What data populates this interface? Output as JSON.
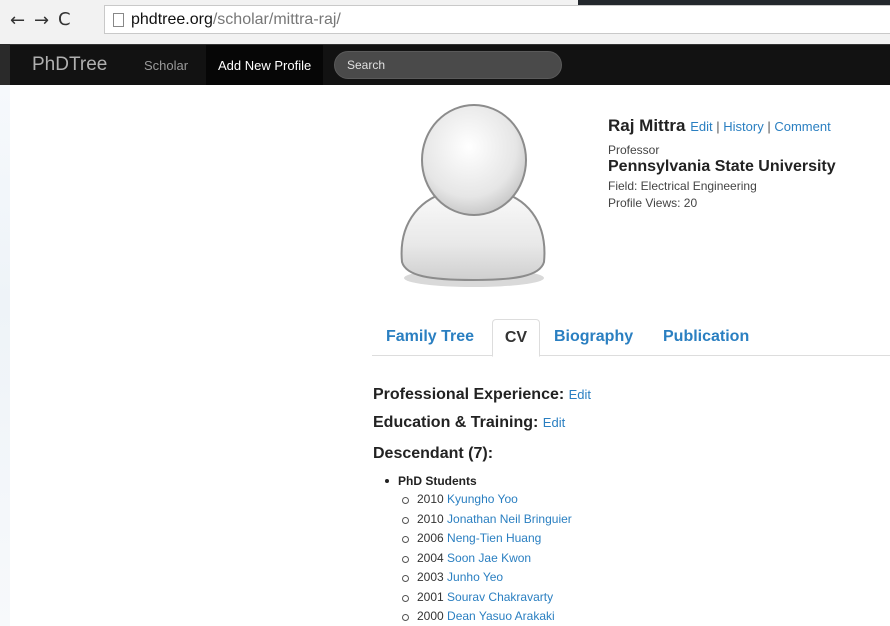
{
  "browser": {
    "url_host": "phdtree.org",
    "url_path": "/scholar/mittra-raj/",
    "back_icon": "←",
    "forward_icon": "→",
    "reload_icon": "C"
  },
  "navbar": {
    "brand": "PhDTree",
    "scholar": "Scholar",
    "add_profile": "Add New Profile",
    "search_placeholder": "Search"
  },
  "profile": {
    "name": "Raj Mittra",
    "edit": "Edit",
    "history": "History",
    "comment": "Comment",
    "separator": "|",
    "role": "Professor",
    "university": "Pennsylvania State University",
    "field": "Field: Electrical Engineering",
    "views": "Profile Views: 20"
  },
  "tabs": {
    "family_tree": "Family Tree",
    "cv": "CV",
    "biography": "Biography",
    "publication": "Publication"
  },
  "cv": {
    "experience_label": "Professional Experience:",
    "education_label": "Education & Training:",
    "descendant_label": "Descendant (7):",
    "edit": "Edit",
    "phd_heading": "PhD Students",
    "students": [
      {
        "year": "2010",
        "name": "Kyungho Yoo"
      },
      {
        "year": "2010",
        "name": "Jonathan Neil Bringuier"
      },
      {
        "year": "2006",
        "name": "Neng-Tien Huang"
      },
      {
        "year": "2004",
        "name": "Soon Jae Kwon"
      },
      {
        "year": "2003",
        "name": "Junho Yeo"
      },
      {
        "year": "2001",
        "name": "Sourav Chakravarty"
      },
      {
        "year": "2000",
        "name": "Dean Yasuo Arakaki"
      }
    ]
  },
  "colors": {
    "link": "#2a7fc1",
    "navbar": "#121212"
  }
}
